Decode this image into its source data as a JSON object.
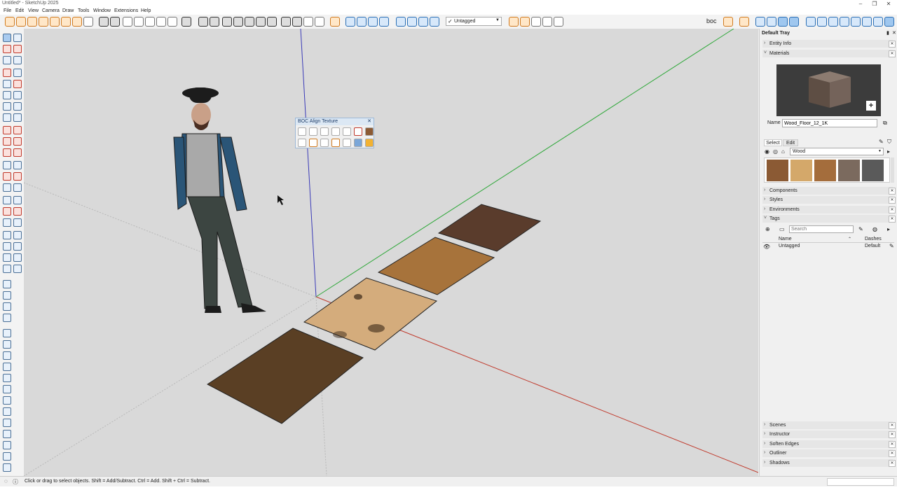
{
  "window": {
    "title": "Untitled* - SketchUp 2025",
    "controls": [
      "–",
      "❐",
      "✕"
    ]
  },
  "menu": [
    "File",
    "Edit",
    "View",
    "Camera",
    "Draw",
    "Tools",
    "Window",
    "Extensions",
    "Help"
  ],
  "toolbar": {
    "tag_dropdown": "Untagged",
    "boc_label": "boc"
  },
  "dialog": {
    "title": "BOC Align Texture",
    "close": "✕",
    "row1_icons": [
      "boc-rotate-icon",
      "boc-flip-icon",
      "boc-reset-icon",
      "boc-move-icon",
      "boc-fit-icon",
      "boc-align-icon",
      "boc-sample-icon"
    ],
    "row2_icons": [
      "boc-pick-icon",
      "boc-copy-icon",
      "boc-tweak-icon",
      "boc-adjust-icon",
      "boc-random-icon",
      "boc-palette-icon",
      "boc-settings-icon"
    ]
  },
  "tray": {
    "title": "Default Tray",
    "entity_info": "Entity Info",
    "materials": "Materials",
    "material_name_label": "Name",
    "material_name": "Wood_Floor_12_1K",
    "add_material_label": "+",
    "tab_select": "Select",
    "tab_edit": "Edit",
    "library": "Wood",
    "swatches": [
      "#8b5a34",
      "#d4a86a",
      "#a46d3c",
      "#7b6a5e",
      "#5a5a5a"
    ],
    "components": "Components",
    "styles": "Styles",
    "environments": "Environments",
    "tags": "Tags",
    "search_placeholder": "Search",
    "col_name": "Name",
    "col_dashes": "Dashes",
    "tag_row_name": "Untagged",
    "tag_row_dashes": "Default",
    "bottom_sections": [
      "Scenes",
      "Instructor",
      "Soften Edges",
      "Outliner",
      "Shadows"
    ]
  },
  "status": {
    "text": "Click or drag to select objects. Shift = Add/Subtract. Ctrl = Add. Shift + Ctrl = Subtract."
  },
  "colors": {
    "axis_red": "#c0392b",
    "axis_green": "#2fa83a",
    "axis_blue": "#3a3ab8",
    "viewport_bg": "#d9d9d9",
    "tile1": "#5a3c2c",
    "tile2": "#a7733b",
    "tile3": "#d4ac7c",
    "tile4": "#5a3f24"
  }
}
